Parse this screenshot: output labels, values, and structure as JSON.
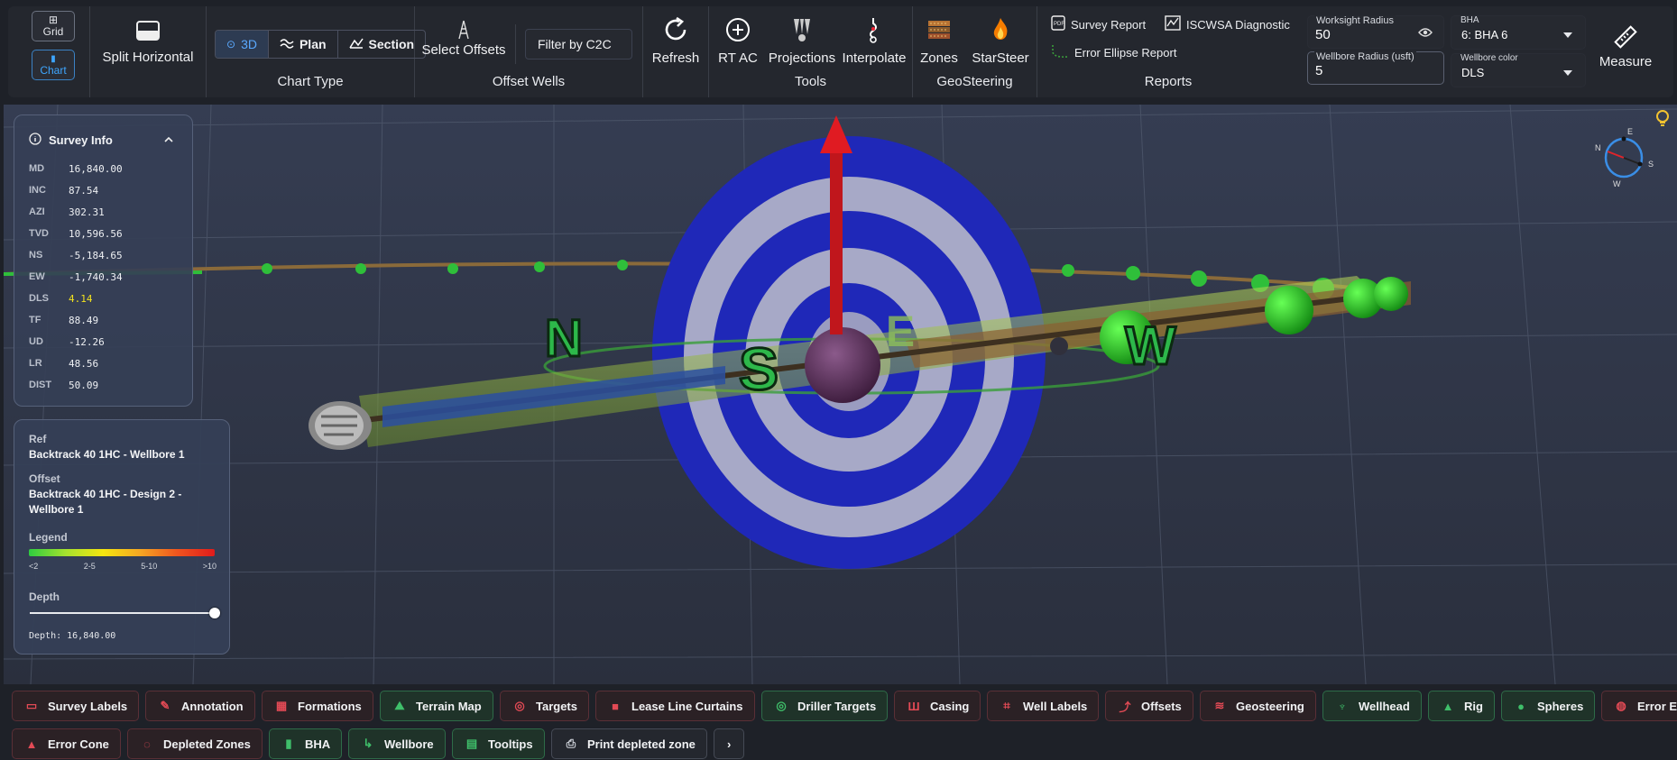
{
  "toolbar": {
    "grid_label": "Grid",
    "chart_label": "Chart",
    "split_label": "Split Horizontal",
    "chart_type": {
      "caption": "Chart Type",
      "options": [
        "3D",
        "Plan",
        "Section"
      ],
      "selected": "3D"
    },
    "offset_wells": {
      "caption": "Offset Wells",
      "select_label": "Select Offsets",
      "filter_placeholder": "Filter by C2C"
    },
    "refresh_label": "Refresh",
    "tools": {
      "caption": "Tools",
      "rt_ac": "RT AC",
      "projections": "Projections",
      "interpolate": "Interpolate"
    },
    "geosteering": {
      "caption": "GeoSteering",
      "zones": "Zones",
      "starsteer": "StarSteer"
    },
    "reports": {
      "caption": "Reports",
      "survey_report": "Survey Report",
      "iscwsa": "ISCWSA Diagnostic",
      "error_ellipse": "Error Ellipse Report"
    },
    "worksight_radius": {
      "label": "Worksight Radius",
      "value": "50"
    },
    "wellbore_radius": {
      "label": "Wellbore Radius (usft)",
      "value": "5"
    },
    "bha": {
      "label": "BHA",
      "value": "6: BHA 6"
    },
    "wellbore_color": {
      "label": "Wellbore color",
      "value": "DLS"
    },
    "measure_label": "Measure"
  },
  "survey_info": {
    "title": "Survey Info",
    "rows": [
      {
        "key": "MD",
        "value": "16,840.00"
      },
      {
        "key": "INC",
        "value": "87.54"
      },
      {
        "key": "AZI",
        "value": "302.31"
      },
      {
        "key": "TVD",
        "value": "10,596.56"
      },
      {
        "key": "NS",
        "value": "-5,184.65"
      },
      {
        "key": "EW",
        "value": "-1,740.34"
      },
      {
        "key": "DLS",
        "value": "4.14"
      },
      {
        "key": "TF",
        "value": "88.49"
      },
      {
        "key": "UD",
        "value": "-12.26"
      },
      {
        "key": "LR",
        "value": "48.56"
      },
      {
        "key": "DIST",
        "value": "50.09"
      }
    ]
  },
  "ref_panel": {
    "ref_label": "Ref",
    "ref_value": "Backtrack 40 1HC - Wellbore 1",
    "offset_label": "Offset",
    "offset_value": "Backtrack 40 1HC - Design 2 - Wellbore 1",
    "legend_label": "Legend",
    "legend_ticks": [
      "<2",
      "2-5",
      "5-10",
      ">10"
    ],
    "legend_colors": [
      "#2ecc40",
      "#a6e22e",
      "#f5e50f",
      "#f5a623",
      "#f0541e",
      "#e01b1b"
    ],
    "depth_label": "Depth",
    "depth_fraction": 1.0,
    "depth_text": "Depth: 16,840.00"
  },
  "scene": {
    "directions": [
      "N",
      "S",
      "E",
      "W"
    ],
    "compass": [
      "N",
      "E",
      "S",
      "W"
    ]
  },
  "chips": [
    {
      "label": "Survey Labels",
      "state": "off"
    },
    {
      "label": "Annotation",
      "state": "off"
    },
    {
      "label": "Formations",
      "state": "off"
    },
    {
      "label": "Terrain Map",
      "state": "on"
    },
    {
      "label": "Targets",
      "state": "off"
    },
    {
      "label": "Lease Line Curtains",
      "state": "off"
    },
    {
      "label": "Driller Targets",
      "state": "on"
    },
    {
      "label": "Casing",
      "state": "off"
    },
    {
      "label": "Well Labels",
      "state": "off"
    },
    {
      "label": "Offsets",
      "state": "off"
    },
    {
      "label": "Geosteering",
      "state": "off"
    },
    {
      "label": "Wellhead",
      "state": "on"
    },
    {
      "label": "Rig",
      "state": "on"
    },
    {
      "label": "Spheres",
      "state": "on"
    },
    {
      "label": "Error Ellipses",
      "state": "off"
    },
    {
      "label": "Error Cone",
      "state": "off"
    },
    {
      "label": "Depleted Zones",
      "state": "off"
    },
    {
      "label": "BHA",
      "state": "on"
    },
    {
      "label": "Wellbore",
      "state": "on"
    },
    {
      "label": "Tooltips",
      "state": "on"
    },
    {
      "label": "Print depleted zone",
      "state": "neutral"
    }
  ]
}
